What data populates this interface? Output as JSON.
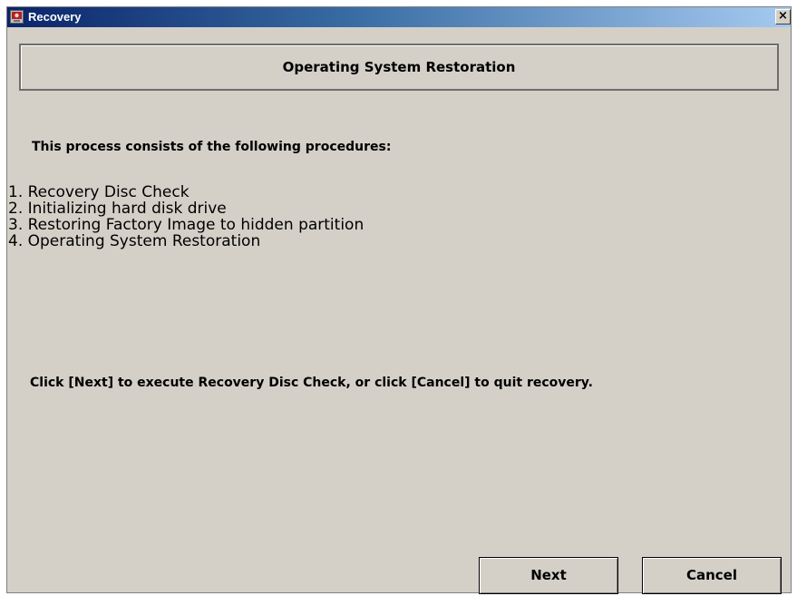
{
  "window": {
    "title": "Recovery",
    "app_icon": "recovery-app-icon",
    "close_label": "×"
  },
  "header": {
    "title": "Operating System Restoration"
  },
  "content": {
    "intro": "This process consists of the following procedures:",
    "steps": [
      "1. Recovery Disc Check",
      "2. Initializing hard disk drive",
      "3. Restoring Factory Image to hidden partition",
      "4. Operating System Restoration"
    ],
    "instruction": "Click [Next] to execute Recovery Disc Check, or click [Cancel] to quit recovery."
  },
  "buttons": {
    "next_label": "Next",
    "cancel_label": "Cancel"
  },
  "colors": {
    "titlebar_start": "#0a246a",
    "titlebar_end": "#a6caf0",
    "dialog_face": "#d4d0c8"
  }
}
